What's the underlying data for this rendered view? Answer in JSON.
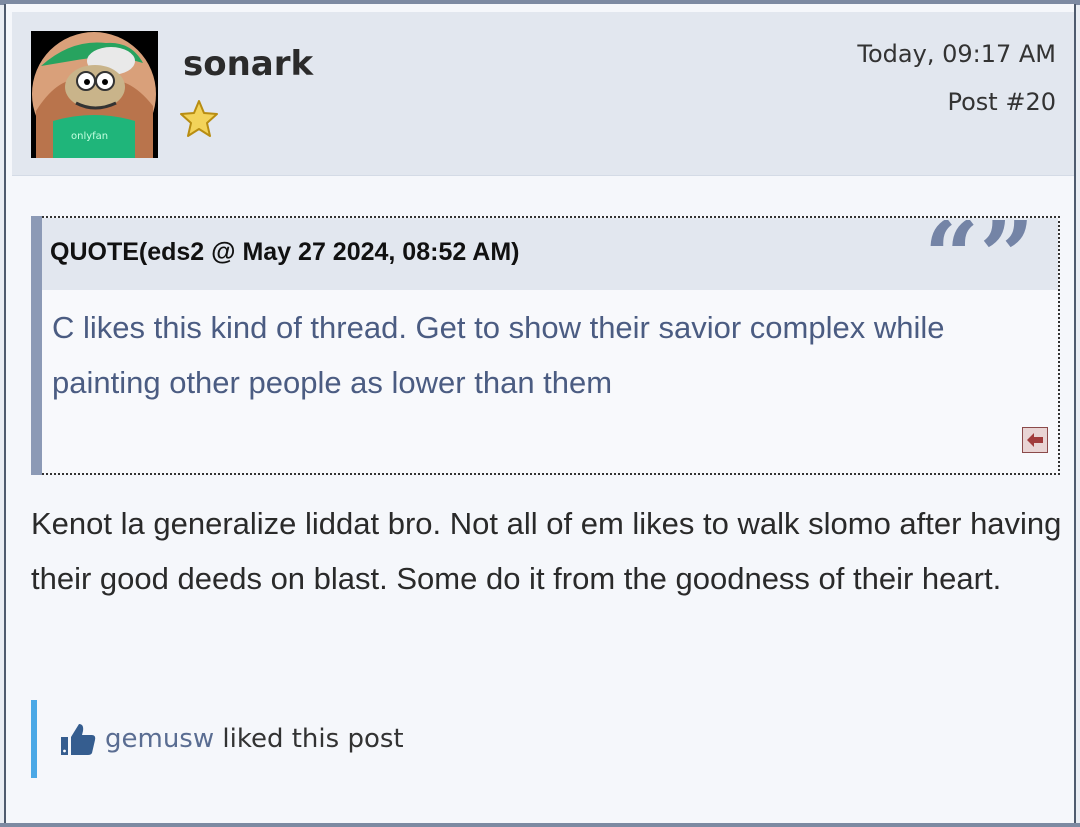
{
  "post": {
    "username": "sonark",
    "timestamp": "Today, 09:17 AM",
    "post_number": "Post #20",
    "avatar_icon": "avatar-image",
    "rank_icon": "star-icon"
  },
  "quote": {
    "header": "QUOTE(eds2 @ May 27 2024, 08:52 AM)",
    "body": "C likes this kind of thread. Get to show their savior complex while painting other people as lower than them",
    "back_icon": "back-arrow-icon"
  },
  "message": {
    "text": "Kenot la generalize liddat bro. Not all of em likes to walk slomo after having their good deeds on blast. Some do it from the goodness of their heart."
  },
  "likes": {
    "user": "gemusw",
    "suffix": " liked this post",
    "icon": "thumbs-up-icon"
  },
  "colors": {
    "header_bg": "#e2e7ef",
    "quote_text": "#4b5c82",
    "like_bar": "#4aa8e6",
    "accent_border": "#8c9ab6"
  }
}
